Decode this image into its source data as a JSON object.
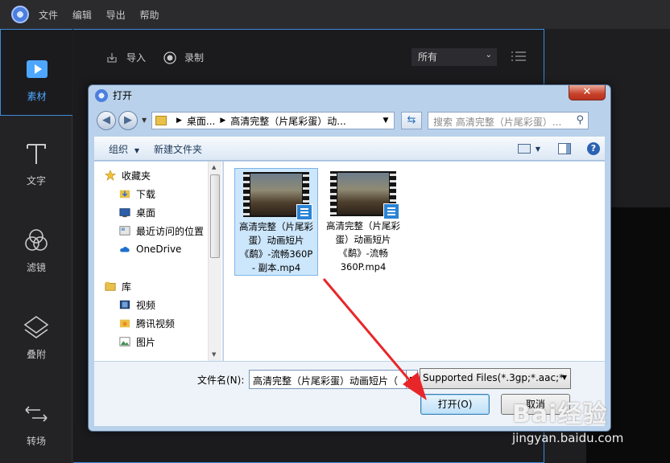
{
  "app": {
    "menu": [
      "文件",
      "编辑",
      "导出",
      "帮助"
    ]
  },
  "sidebar": {
    "items": [
      {
        "label": "素材",
        "icon": "media-icon"
      },
      {
        "label": "文字",
        "icon": "text-icon"
      },
      {
        "label": "滤镜",
        "icon": "filter-icon"
      },
      {
        "label": "叠附",
        "icon": "overlay-icon"
      },
      {
        "label": "转场",
        "icon": "transition-icon"
      }
    ]
  },
  "main": {
    "import_label": "导入",
    "record_label": "录制",
    "filter_value": "所有"
  },
  "dialog": {
    "title": "打开",
    "close_symbol": "✕",
    "address": {
      "part1": "桌面...",
      "part2": "高清完整（片尾彩蛋）动..."
    },
    "search_placeholder": "搜索 高清完整（片尾彩蛋）...",
    "toolbar": {
      "organize": "组织",
      "new_folder": "新建文件夹"
    },
    "nav": {
      "favorites": "收藏夹",
      "downloads": "下载",
      "desktop": "桌面",
      "recent": "最近访问的位置",
      "onedrive": "OneDrive",
      "libraries": "库",
      "videos": "视频",
      "tencent_video": "腾讯视频",
      "pictures": "图片"
    },
    "files": [
      {
        "name": "高清完整（片尾彩蛋）动画短片《鹬》-流畅360P - 副本.mp4",
        "selected": true
      },
      {
        "name": "高清完整（片尾彩蛋）动画短片《鹬》-流畅360P.mp4",
        "selected": false
      }
    ],
    "filename_label": "文件名(N):",
    "filename_value": "高清完整（片尾彩蛋）动画短片（",
    "filetype_value": "Supported Files(*.3gp;*.aac;*",
    "open_button": "打开(O)",
    "cancel_button": "取消"
  },
  "watermark": {
    "logo": "Bai经验",
    "url": "jingyan.baidu.com"
  },
  "colors": {
    "accent": "#3b8bd8",
    "annotation_arrow": "#e8262a"
  }
}
